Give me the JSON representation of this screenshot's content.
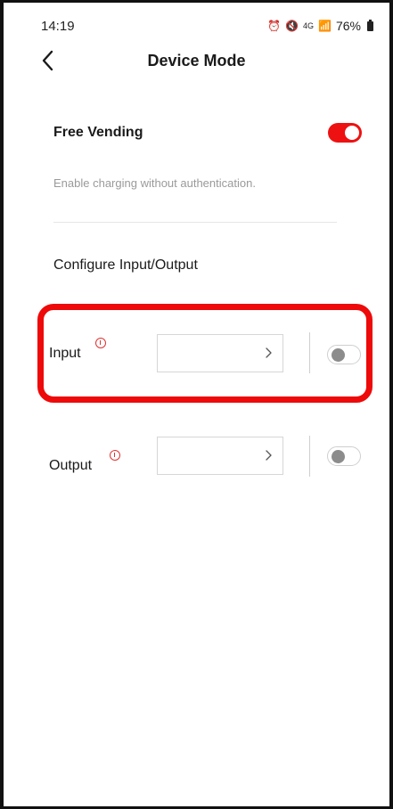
{
  "status_bar": {
    "time": "14:19",
    "icons": [
      "alarm-icon",
      "mute-icon",
      "4g-icon",
      "signal-icon"
    ],
    "battery": "76%"
  },
  "header": {
    "title": "Device Mode",
    "back_icon": "chevron-left-icon"
  },
  "free_vending": {
    "label": "Free Vending",
    "enabled": true,
    "description": "Enable charging without authentication."
  },
  "io_section": {
    "title": "Configure Input/Output",
    "rows": [
      {
        "label": "Input",
        "value": "",
        "enabled": false,
        "highlighted": true
      },
      {
        "label": "Output",
        "value": "",
        "enabled": false,
        "highlighted": false
      }
    ]
  },
  "colors": {
    "accent": "#ee1111",
    "warning": "#e03030",
    "highlight": "#ee0a0a",
    "muted_text": "#9a9a9a"
  }
}
